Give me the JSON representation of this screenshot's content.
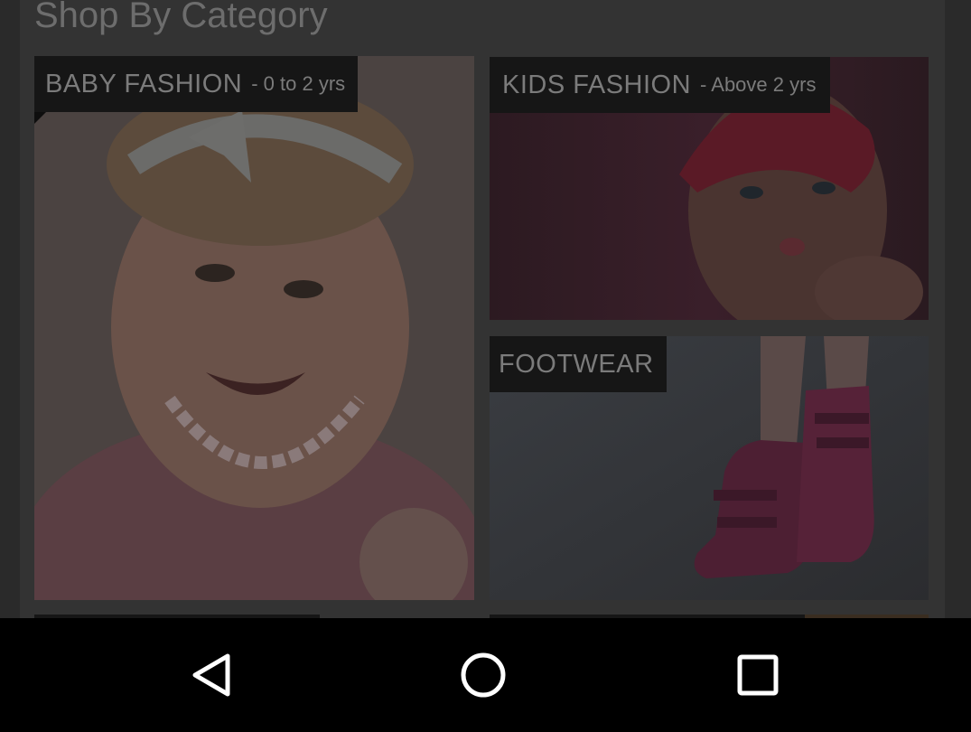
{
  "section": {
    "title": "Shop By Category"
  },
  "categories": [
    {
      "label": "BABY FASHION",
      "sublabel": "- 0 to 2 yrs"
    },
    {
      "label": "KIDS FASHION",
      "sublabel": "- Above 2 yrs"
    },
    {
      "label": "FOOTWEAR",
      "sublabel": ""
    }
  ],
  "navbar": {
    "back": "back-triangle-icon",
    "home": "home-circle-icon",
    "recents": "recents-square-icon"
  },
  "colors": {
    "navbar_bg": "#000000",
    "ribbon_bg": "#161616",
    "overlay": "#2a2a2a"
  }
}
